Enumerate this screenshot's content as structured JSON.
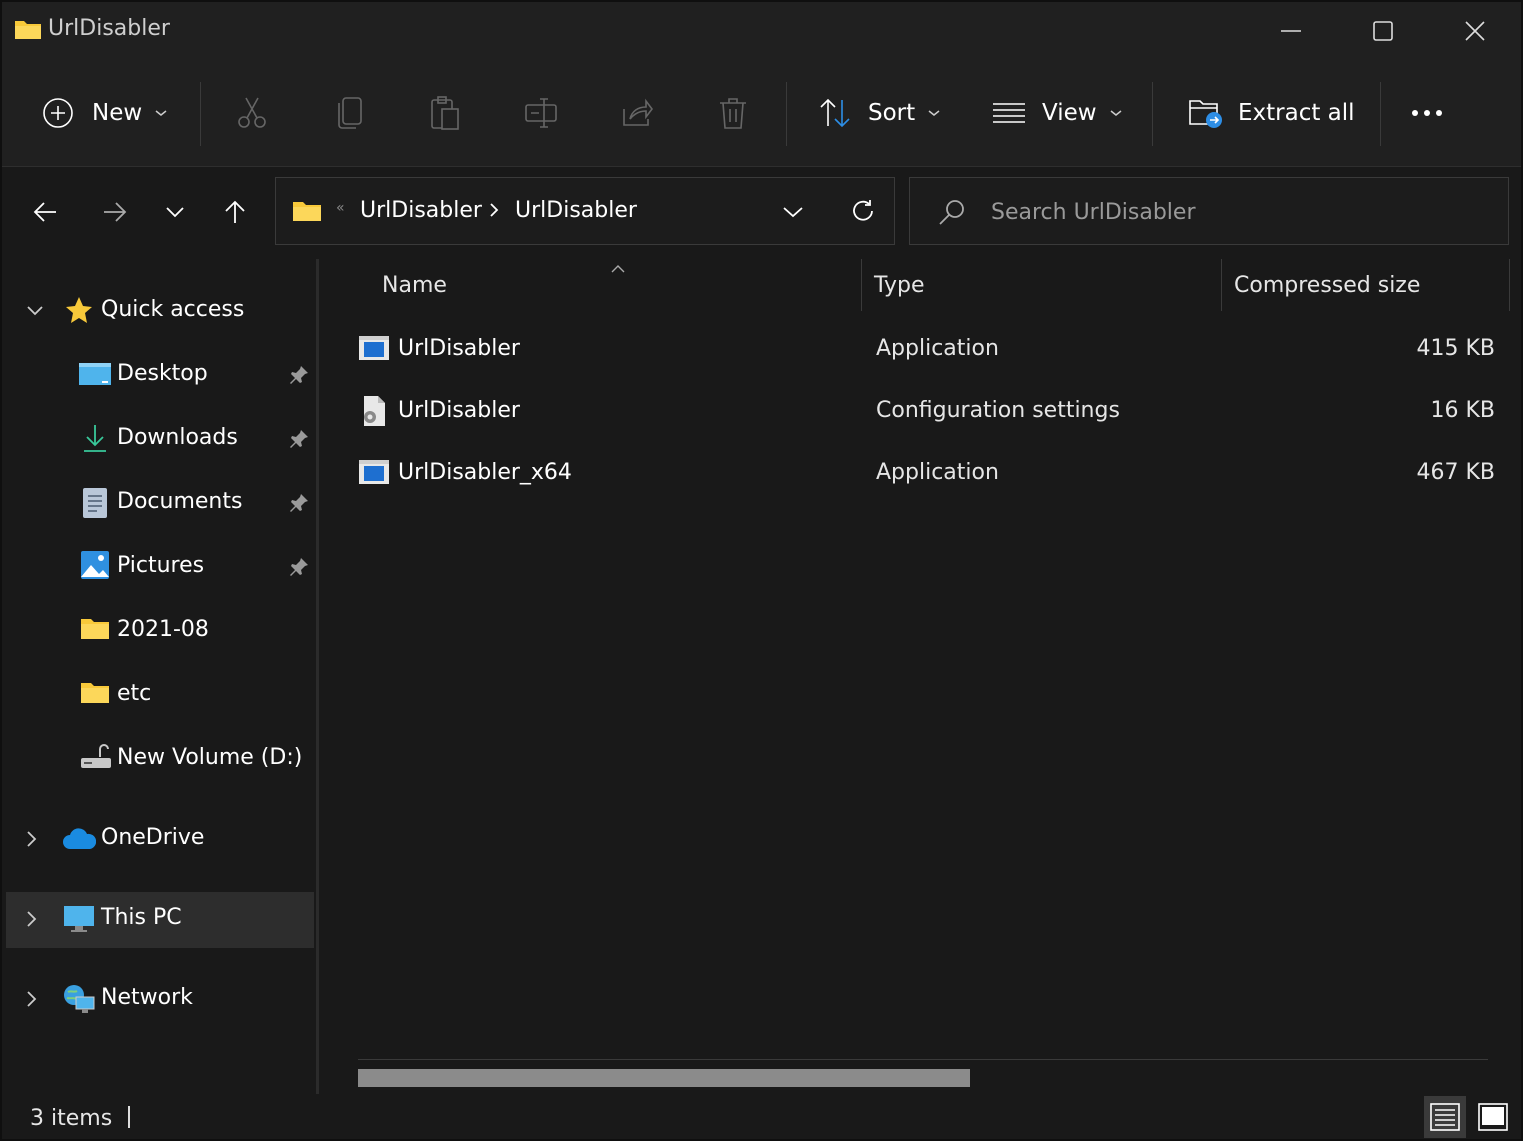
{
  "window": {
    "title": "UrlDisabler"
  },
  "toolbar": {
    "new_label": "New",
    "sort_label": "Sort",
    "view_label": "View",
    "extract_label": "Extract all"
  },
  "address": {
    "crumbs": [
      "UrlDisabler",
      "UrlDisabler"
    ],
    "search_placeholder": "Search UrlDisabler"
  },
  "sidebar": {
    "quick_access": "Quick access",
    "items": [
      {
        "label": "Desktop",
        "pinned": true
      },
      {
        "label": "Downloads",
        "pinned": true
      },
      {
        "label": "Documents",
        "pinned": true
      },
      {
        "label": "Pictures",
        "pinned": true
      },
      {
        "label": "2021-08",
        "pinned": false
      },
      {
        "label": "etc",
        "pinned": false
      },
      {
        "label": "New Volume (D:)",
        "pinned": false
      }
    ],
    "onedrive": "OneDrive",
    "this_pc": "This PC",
    "network": "Network"
  },
  "columns": {
    "name": "Name",
    "type": "Type",
    "size": "Compressed size"
  },
  "files": [
    {
      "name": "UrlDisabler",
      "type": "Application",
      "size": "415 KB",
      "icon": "application-icon"
    },
    {
      "name": "UrlDisabler",
      "type": "Configuration settings",
      "size": "16 KB",
      "icon": "config-settings-icon"
    },
    {
      "name": "UrlDisabler_x64",
      "type": "Application",
      "size": "467 KB",
      "icon": "application-icon"
    }
  ],
  "status": {
    "items": "3 items"
  },
  "colors": {
    "background": "#191919",
    "chrome": "#202020",
    "folder": "#f8c93a",
    "accent": "#2d8ee6"
  }
}
